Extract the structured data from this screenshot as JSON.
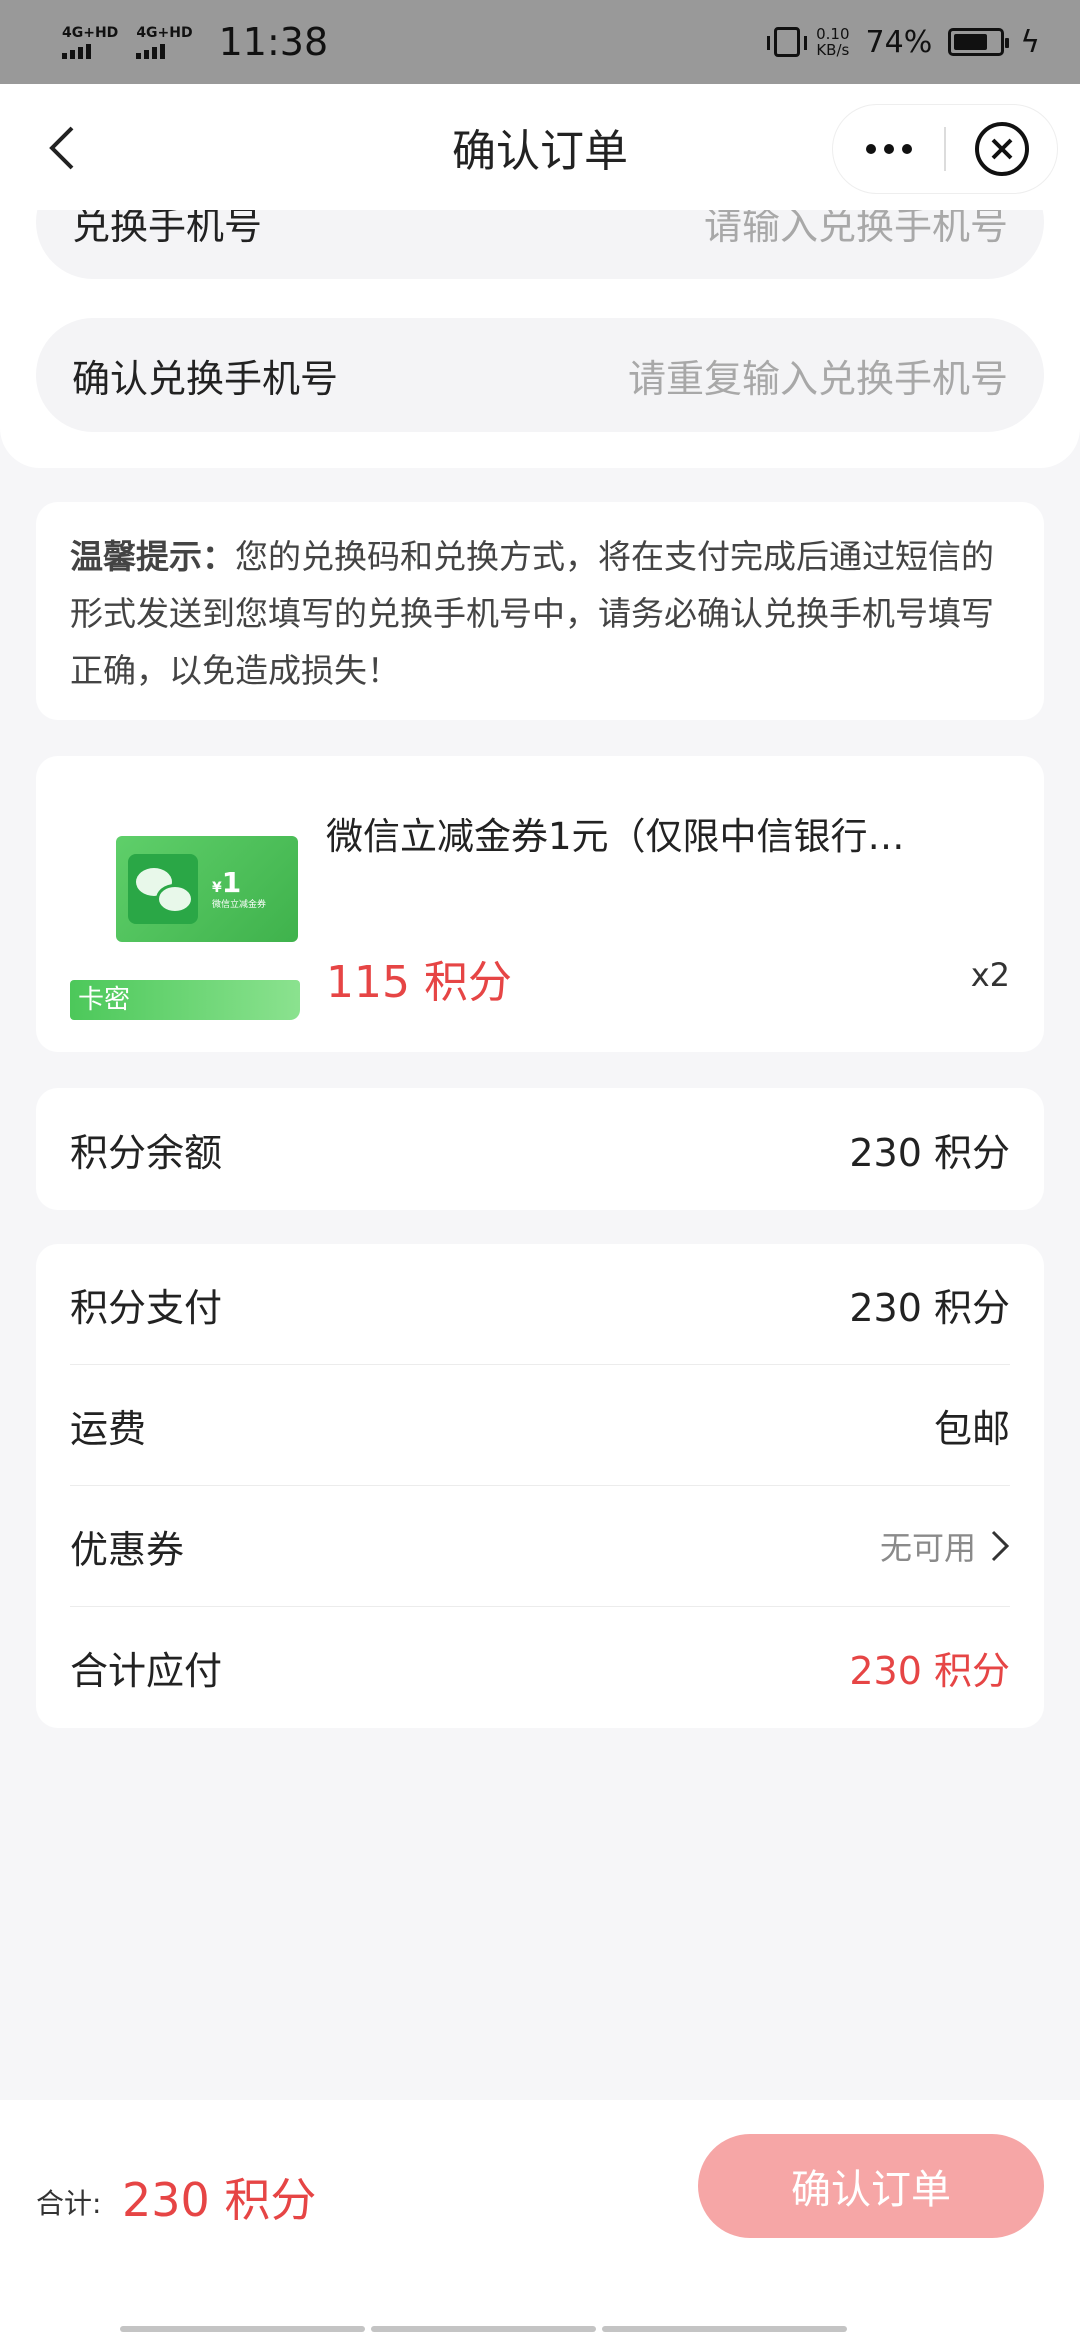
{
  "status_bar": {
    "network1": "4G+HD",
    "network2": "4G+HD",
    "time": "11:38",
    "speed_value": "0.10",
    "speed_unit": "KB/s",
    "battery": "74%"
  },
  "nav": {
    "title": "确认订单"
  },
  "form": {
    "phone_label": "兑换手机号",
    "phone_placeholder": "请输入兑换手机号",
    "confirm_phone_label": "确认兑换手机号",
    "confirm_phone_placeholder": "请重复输入兑换手机号"
  },
  "notice": {
    "title": "温馨提示：",
    "text": "您的兑换码和兑换方式，将在支付完成后通过短信的形式发送到您填写的兑换手机号中，请务必确认兑换手机号填写正确，以免造成损失！"
  },
  "product": {
    "title": "微信立减金券1元（仅限中信银行…",
    "price": "115 积分",
    "quantity": "x2",
    "tag": "卡密",
    "coupon_amount": "1",
    "coupon_symbol": "¥",
    "coupon_subtitle": "微信立减金券"
  },
  "balance": {
    "label": "积分余额",
    "value": "230 积分"
  },
  "summary": {
    "rows": [
      {
        "label": "积分支付",
        "value": "230 积分"
      },
      {
        "label": "运费",
        "value": "包邮"
      },
      {
        "label": "优惠券",
        "value": "无可用"
      },
      {
        "label": "合计应付",
        "value": "230 积分"
      }
    ]
  },
  "footer": {
    "total_label": "合计:",
    "total_value": "230 积分",
    "confirm_label": "确认订单"
  },
  "colors": {
    "accent_red": "#e64545",
    "button_pink": "#f6a6a6",
    "wechat_green": "#3fb24c"
  }
}
